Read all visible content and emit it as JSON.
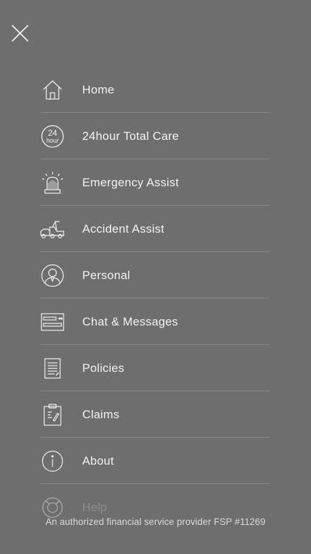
{
  "menu": {
    "items": [
      {
        "label": "Home",
        "icon": "home-icon"
      },
      {
        "label": "24hour Total Care",
        "icon": "24hour-icon"
      },
      {
        "label": "Emergency Assist",
        "icon": "siren-icon"
      },
      {
        "label": "Accident Assist",
        "icon": "tow-truck-icon"
      },
      {
        "label": "Personal",
        "icon": "person-icon"
      },
      {
        "label": "Chat & Messages",
        "icon": "chat-icon"
      },
      {
        "label": "Policies",
        "icon": "document-icon"
      },
      {
        "label": "Claims",
        "icon": "clipboard-icon"
      },
      {
        "label": "About",
        "icon": "info-icon"
      },
      {
        "label": "Help",
        "icon": "lifebuoy-icon"
      }
    ]
  },
  "icon_24hour": {
    "top": "24",
    "bottom": "hour"
  },
  "footer": {
    "text": "An authorized financial service provider FSP #11269"
  },
  "colors": {
    "background": "#6e6e6e",
    "text": "#f3f3f3",
    "divider": "#888888"
  }
}
